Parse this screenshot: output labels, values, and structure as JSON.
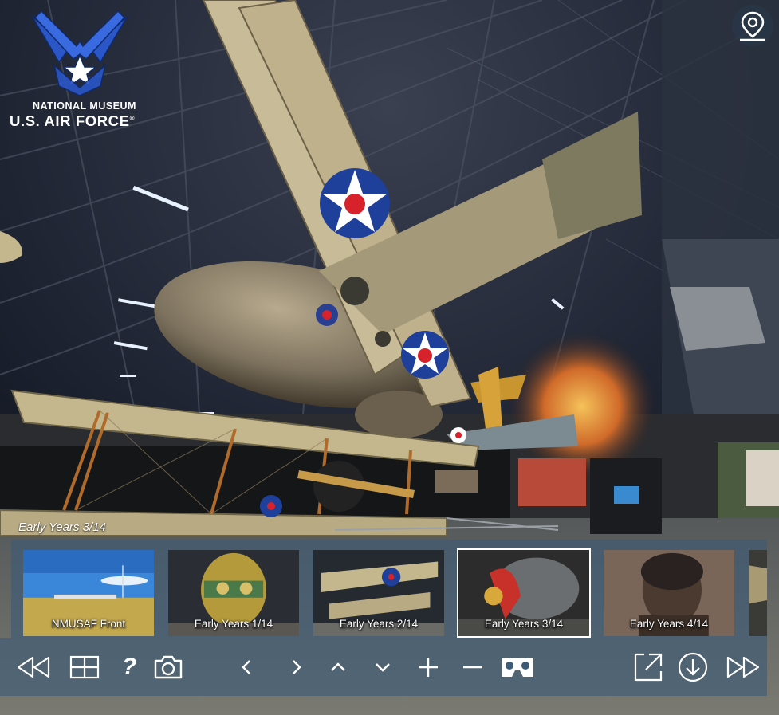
{
  "logo": {
    "line1": "NATIONAL MUSEUM",
    "line2": "U.S. AIR FORCE",
    "registered": "®"
  },
  "current_scene": "Early Years 3/14",
  "thumbnails": [
    {
      "label": "NMUSAF Front",
      "active": false
    },
    {
      "label": "Early Years 1/14",
      "active": false
    },
    {
      "label": "Early Years 2/14",
      "active": false
    },
    {
      "label": "Early Years 3/14",
      "active": true
    },
    {
      "label": "Early Years 4/14",
      "active": false
    }
  ],
  "toolbar": [
    "rewind-icon",
    "grid-icon",
    "help-icon",
    "camera-icon",
    "chevron-left-icon",
    "chevron-right-icon",
    "chevron-up-icon",
    "chevron-down-icon",
    "plus-icon",
    "minus-icon",
    "vr-headset-icon",
    "fullscreen-icon",
    "download-icon",
    "fast-forward-icon"
  ],
  "toolbar_help_glyph": "?",
  "colors": {
    "panel": "#3c5a78",
    "accent_blue": "#1e3f9a",
    "roundel_red": "#d8222b"
  }
}
